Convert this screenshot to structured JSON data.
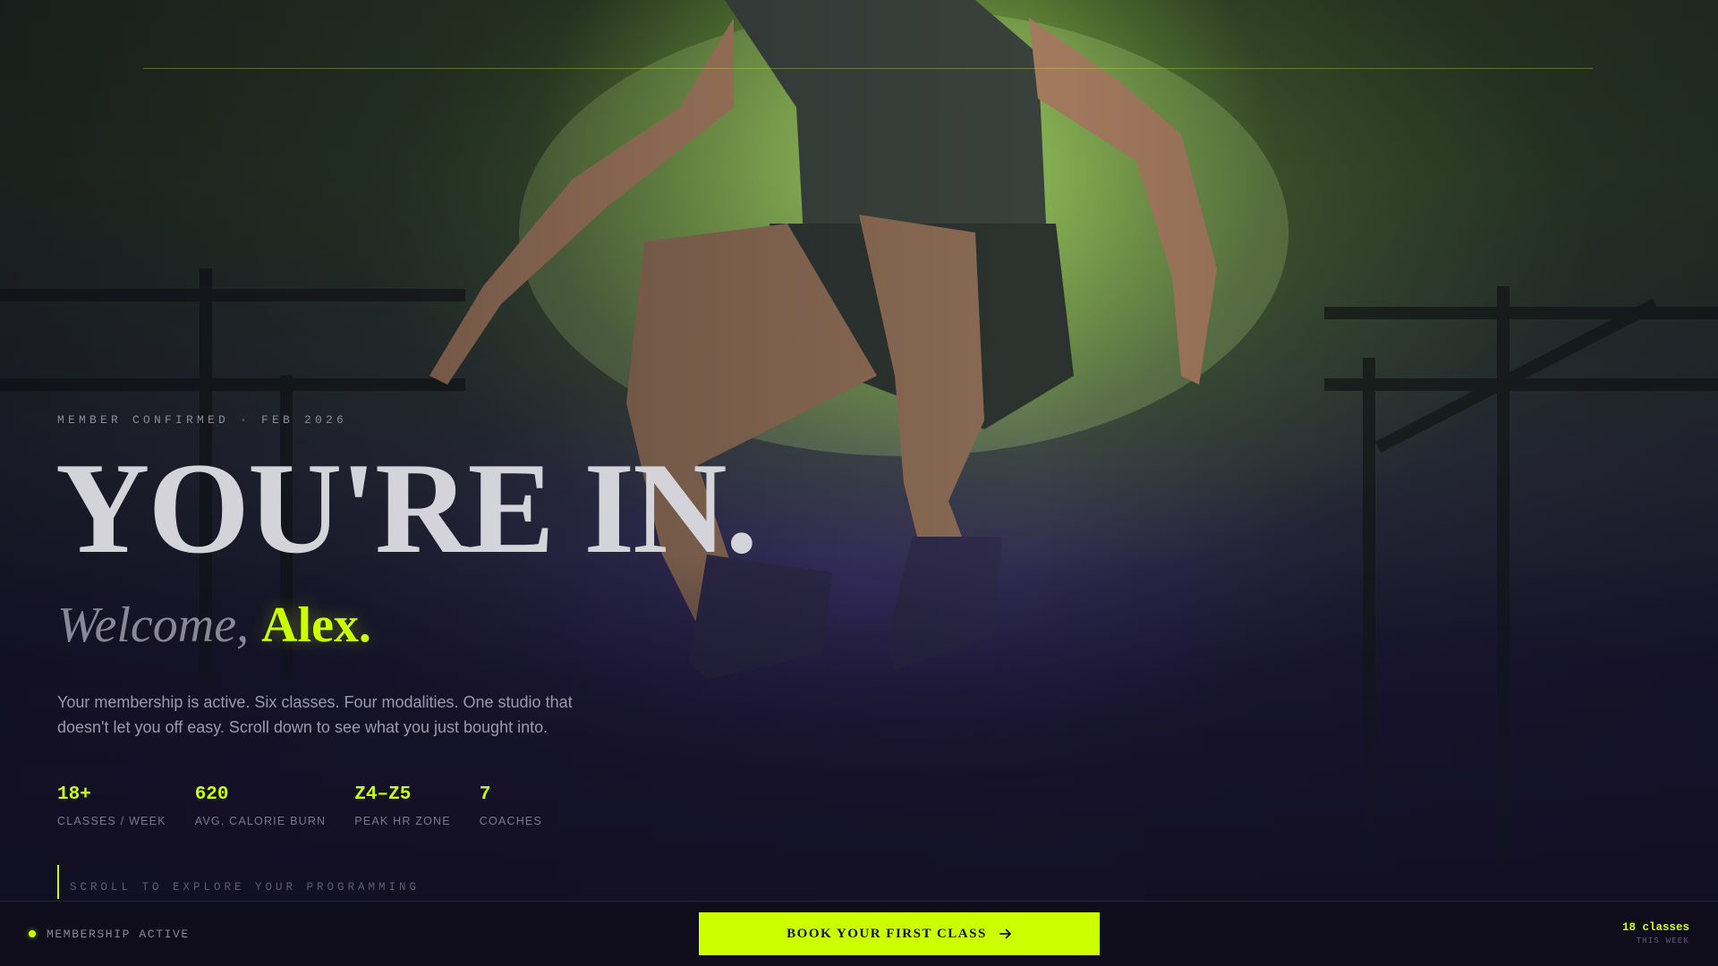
{
  "hero": {
    "eyebrow": "MEMBER CONFIRMED · FEB 2026",
    "headline": "YOU'RE IN.",
    "greeting": "Welcome,",
    "name": "Alex.",
    "lead": "Your membership is active. Six classes. Four modalities. One studio that doesn't let you off easy. Scroll down to see what you just bought into."
  },
  "stats": [
    {
      "value": "18+",
      "label": "CLASSES / WEEK"
    },
    {
      "value": "620",
      "label": "AVG. CALORIE BURN"
    },
    {
      "value": "Z4–Z5",
      "label": "PEAK HR ZONE"
    },
    {
      "value": "7",
      "label": "COACHES"
    }
  ],
  "scroll_cue": "SCROLL TO EXPLORE YOUR PROGRAMMING",
  "bottom_bar": {
    "status": "MEMBERSHIP ACTIVE",
    "cta_label": "BOOK YOUR FIRST CLASS",
    "cta_icon": "arrow-right-icon",
    "weekly_count": "18 classes",
    "weekly_label": "THIS WEEK"
  },
  "colors": {
    "accent": "#ccff00",
    "background": "#12101e"
  }
}
